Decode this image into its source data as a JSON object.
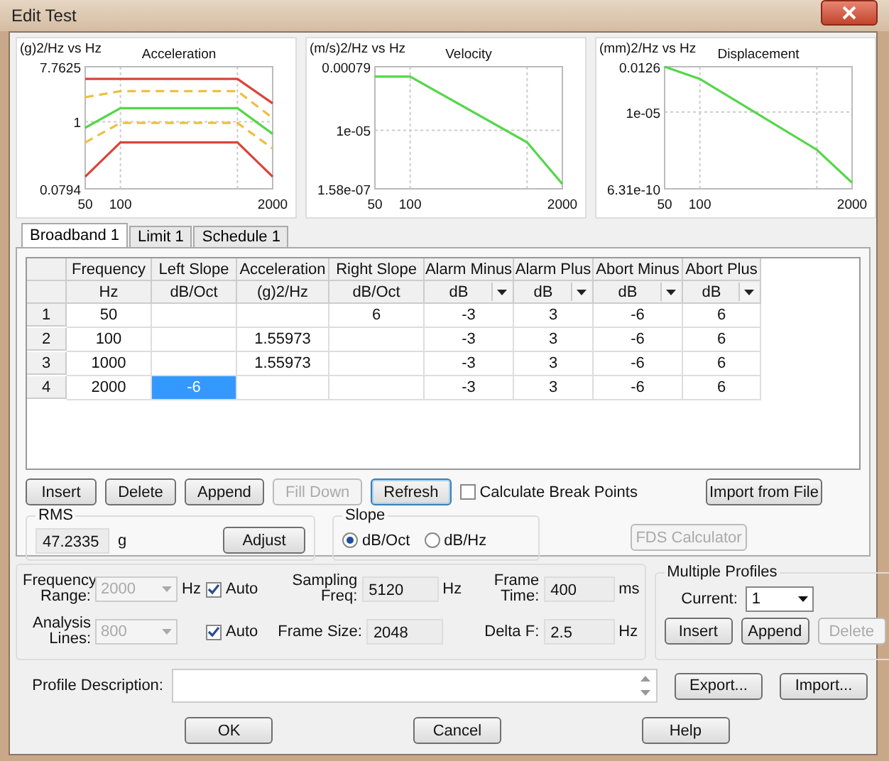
{
  "window": {
    "title": "Edit Test"
  },
  "charts": [
    {
      "kind": "picture",
      "title": "Acceleration",
      "ylabel": "(g)2/Hz vs Hz",
      "y_tick_labels": [
        "7.7625",
        "1",
        "0.0794"
      ],
      "x_tick_labels": [
        "50",
        "100",
        "2000"
      ]
    },
    {
      "kind": "picture",
      "title": "Velocity",
      "ylabel": "(m/s)2/Hz vs Hz",
      "y_tick_labels": [
        "0.00079",
        "1e-05",
        "1.58e-07"
      ],
      "x_tick_labels": [
        "50",
        "100",
        "2000"
      ]
    },
    {
      "kind": "picture",
      "title": "Displacement",
      "ylabel": "(mm)2/Hz vs Hz",
      "y_tick_labels": [
        "0.0126",
        "1e-05",
        "6.31e-10"
      ],
      "x_tick_labels": [
        "50",
        "100",
        "2000"
      ]
    }
  ],
  "tabs": [
    {
      "label": "Broadband 1",
      "selected": true
    },
    {
      "label": "Limit 1",
      "selected": false
    },
    {
      "label": "Schedule 1",
      "selected": false
    }
  ],
  "grid": {
    "columns": [
      {
        "label": "Frequency",
        "unit": "Hz",
        "dropdown": false
      },
      {
        "label": "Left Slope",
        "unit": "dB/Oct",
        "dropdown": false
      },
      {
        "label": "Acceleration",
        "unit": "(g)2/Hz",
        "dropdown": false
      },
      {
        "label": "Right Slope",
        "unit": "dB/Oct",
        "dropdown": false
      },
      {
        "label": "Alarm Minus",
        "unit": "dB",
        "dropdown": true
      },
      {
        "label": "Alarm Plus",
        "unit": "dB",
        "dropdown": true
      },
      {
        "label": "Abort Minus",
        "unit": "dB",
        "dropdown": true
      },
      {
        "label": "Abort Plus",
        "unit": "dB",
        "dropdown": true
      }
    ],
    "rows": [
      {
        "header": "1",
        "cells": [
          {
            "text": "50",
            "selected": false
          },
          {
            "selected": false
          },
          {
            "selected": false
          },
          {
            "text": "6",
            "selected": false
          },
          {
            "text": "-3",
            "selected": false
          },
          {
            "text": "3",
            "selected": false
          },
          {
            "text": "-6",
            "selected": false
          },
          {
            "text": "6",
            "selected": false
          }
        ]
      },
      {
        "header": "2",
        "cells": [
          {
            "text": "100",
            "selected": false
          },
          {
            "selected": false
          },
          {
            "text": "1.55973",
            "selected": false
          },
          {
            "selected": false
          },
          {
            "text": "-3",
            "selected": false
          },
          {
            "text": "3",
            "selected": false
          },
          {
            "text": "-6",
            "selected": false
          },
          {
            "text": "6",
            "selected": false
          }
        ]
      },
      {
        "header": "3",
        "cells": [
          {
            "text": "1000",
            "selected": false
          },
          {
            "selected": false
          },
          {
            "text": "1.55973",
            "selected": false
          },
          {
            "selected": false
          },
          {
            "text": "-3",
            "selected": false
          },
          {
            "text": "3",
            "selected": false
          },
          {
            "text": "-6",
            "selected": false
          },
          {
            "text": "6",
            "selected": false
          }
        ]
      },
      {
        "header": "4",
        "cells": [
          {
            "text": "2000",
            "selected": false
          },
          {
            "text": "-6",
            "selected": true
          },
          {
            "selected": false
          },
          {
            "selected": false
          },
          {
            "text": "-3",
            "selected": false
          },
          {
            "text": "3",
            "selected": false
          },
          {
            "text": "-6",
            "selected": false
          },
          {
            "text": "6",
            "selected": false
          }
        ]
      }
    ]
  },
  "grid_buttons": [
    {
      "label": "Insert",
      "disabled": false,
      "focused": false
    },
    {
      "label": "Delete",
      "disabled": false,
      "focused": false
    },
    {
      "label": "Append",
      "disabled": false,
      "focused": false
    },
    {
      "label": "Fill Down",
      "disabled": true,
      "focused": false
    },
    {
      "label": "Refresh",
      "disabled": false,
      "focused": true
    }
  ],
  "calculate_break_points": {
    "label": "Calculate Break Points",
    "checked": false
  },
  "import_button": {
    "label": "Import from File",
    "disabled": false
  },
  "rms": {
    "title": "RMS",
    "value": "47.2335",
    "unit": "g",
    "button": "Adjust"
  },
  "slope": {
    "title": "Slope",
    "options": [
      {
        "label": "dB/Oct",
        "selected": true
      },
      {
        "label": "dB/Hz",
        "selected": false
      }
    ]
  },
  "fds_button": {
    "label": "FDS Calculator",
    "disabled": true
  },
  "analysis": {
    "frequency_range": {
      "label": "Frequency Range:",
      "value": "2000",
      "disabled": true,
      "unit": "Hz",
      "auto": {
        "label": "Auto",
        "checked": true
      }
    },
    "analysis_lines": {
      "label": "Analysis Lines:",
      "value": "800",
      "disabled": true,
      "auto": {
        "label": "Auto",
        "checked": true
      }
    },
    "sampling_freq": {
      "label": "Sampling Freq:",
      "value": "5120",
      "unit": "Hz"
    },
    "frame_size": {
      "label": "Frame Size:",
      "value": "2048"
    },
    "frame_time": {
      "label": "Frame Time:",
      "value": "400",
      "unit": "ms"
    },
    "delta_f": {
      "label": "Delta F:",
      "value": "2.5",
      "unit": "Hz"
    }
  },
  "multiple_profiles": {
    "title": "Multiple Profiles",
    "current_label": "Current:",
    "current_value": "1",
    "buttons": [
      {
        "label": "Insert",
        "disabled": false
      },
      {
        "label": "Append",
        "disabled": false
      },
      {
        "label": "Delete",
        "disabled": true
      }
    ]
  },
  "profile_description": {
    "label": "Profile Description:"
  },
  "side_buttons": [
    "Export...",
    "Import..."
  ],
  "footer_buttons": [
    "OK",
    "Cancel",
    "Help"
  ]
}
